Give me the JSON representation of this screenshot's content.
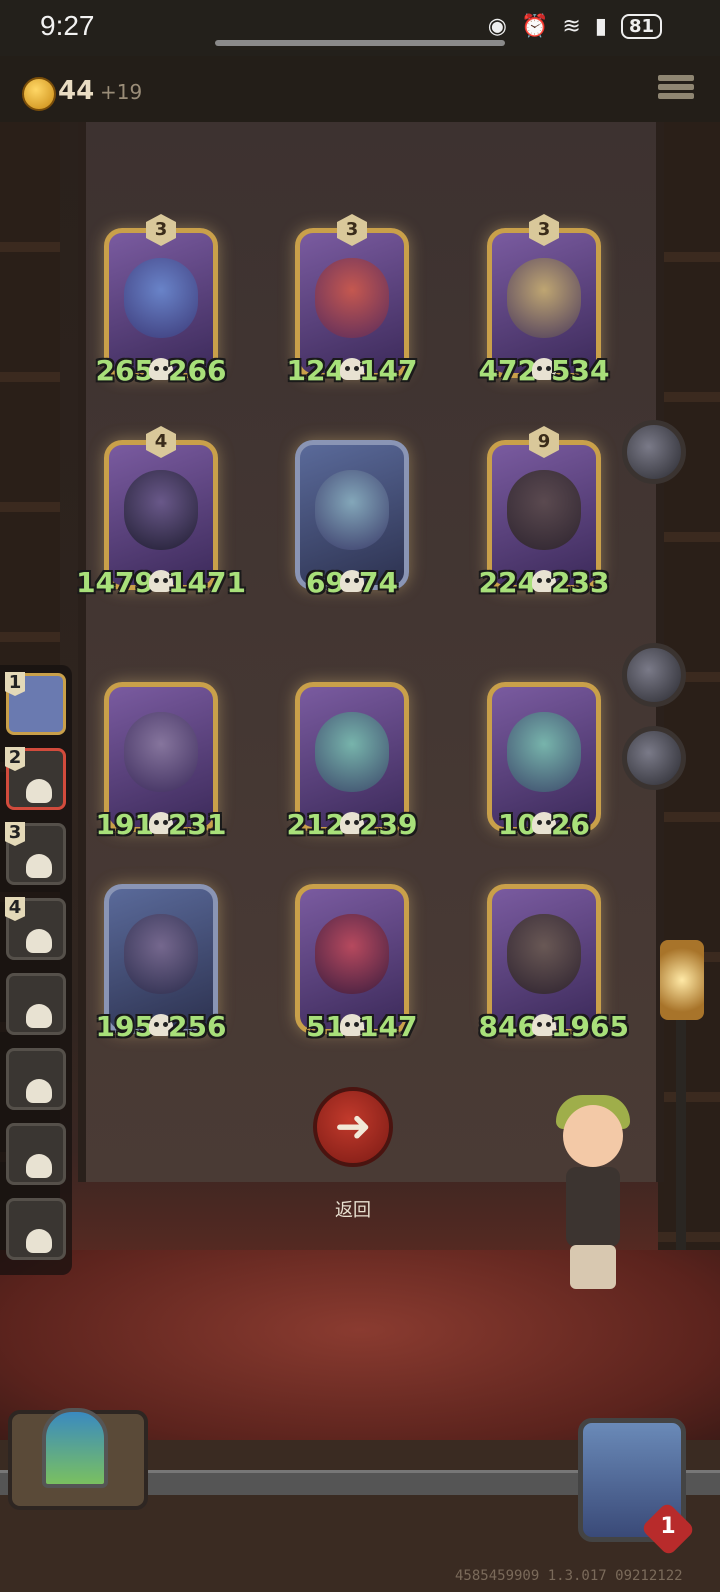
{
  "status_bar": {
    "time": "9:27",
    "battery": "81"
  },
  "hud": {
    "coins": "44",
    "coin_income": "+19"
  },
  "board": {
    "cards": [
      {
        "level": "3",
        "attack": "265",
        "health": "266",
        "name": "wizard",
        "p1": "#6a8ad0",
        "p2": "#3a3a7a"
      },
      {
        "level": "3",
        "attack": "124",
        "health": "147",
        "name": "lobster-chef",
        "p1": "#d05a4a",
        "p2": "#5a2a5a"
      },
      {
        "level": "3",
        "attack": "472",
        "health": "534",
        "name": "golem",
        "p1": "#c9b070",
        "p2": "#4a3a5a"
      },
      {
        "level": "4",
        "attack": "1479",
        "health": "1471",
        "name": "top-hat-gentleman",
        "p1": "#6a5a8a",
        "p2": "#1a1a2a"
      },
      {
        "level": "",
        "attack": "69",
        "health": "74",
        "name": "banshee",
        "p1": "#8ab0c0",
        "p2": "#3a3a6a"
      },
      {
        "level": "9",
        "attack": "224",
        "health": "233",
        "name": "shield-knight",
        "p1": "#5a4a4a",
        "p2": "#2a2228"
      },
      {
        "level": "",
        "attack": "191",
        "health": "231",
        "name": "airship",
        "p1": "#8a7aa0",
        "p2": "#3a2a5a"
      },
      {
        "level": "",
        "attack": "212",
        "health": "239",
        "name": "fish-mage",
        "p1": "#7ac0b0",
        "p2": "#3a4a6a"
      },
      {
        "level": "",
        "attack": "10",
        "health": "26",
        "name": "fish-mage-copy",
        "p1": "#7ac0b0",
        "p2": "#3a4a6a"
      },
      {
        "level": "",
        "attack": "195",
        "health": "256",
        "name": "wolf-bandit",
        "p1": "#7a6a90",
        "p2": "#2a2a4a"
      },
      {
        "level": "",
        "attack": "51",
        "health": "147",
        "name": "clown",
        "p1": "#c04a5a",
        "p2": "#3a1a3a"
      },
      {
        "level": "",
        "attack": "846",
        "health": "1965",
        "name": "bear-brute",
        "p1": "#6a5a50",
        "p2": "#2a2028"
      }
    ]
  },
  "queue": [
    {
      "num": "1"
    },
    {
      "num": "2"
    },
    {
      "num": "3"
    },
    {
      "num": "4"
    },
    {
      "num": ""
    },
    {
      "num": ""
    },
    {
      "num": ""
    },
    {
      "num": ""
    }
  ],
  "back_button": {
    "label": "返回",
    "icon": "arrow-left-icon"
  },
  "player": {
    "lives": "1"
  },
  "build_id": "4585459909 1.3.017 09212122",
  "colors": {
    "stat_text": "#a8e07a",
    "gold_frame": "#c9a04a",
    "back_red": "#c23a2c"
  }
}
